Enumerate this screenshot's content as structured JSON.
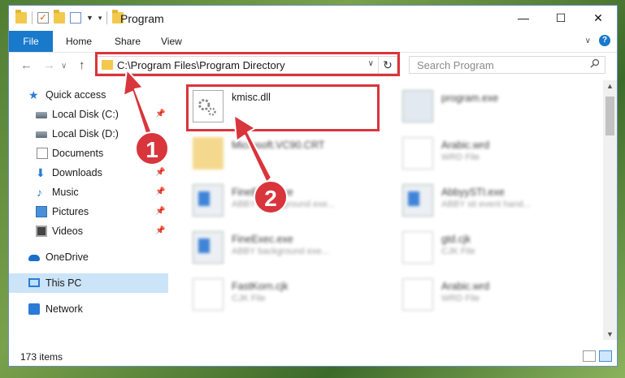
{
  "window": {
    "title": "Program",
    "controls": {
      "minimize": "—",
      "maximize": "☐",
      "close": "✕"
    }
  },
  "ribbon": {
    "file_tab": "File",
    "tabs": [
      "Home",
      "Share",
      "View"
    ],
    "help": "?"
  },
  "navigation": {
    "back": "←",
    "forward": "→",
    "up": "↑",
    "address": "C:\\Program Files\\Program Directory",
    "search_placeholder": "Search Program"
  },
  "sidebar": {
    "items": [
      {
        "label": "Quick access"
      },
      {
        "label": "Local Disk (C:)"
      },
      {
        "label": "Local Disk (D:)"
      },
      {
        "label": "Documents"
      },
      {
        "label": "Downloads"
      },
      {
        "label": "Music"
      },
      {
        "label": "Pictures"
      },
      {
        "label": "Videos"
      },
      {
        "label": "OneDrive"
      },
      {
        "label": "This PC"
      },
      {
        "label": "Network"
      }
    ]
  },
  "files": [
    {
      "name": "kmisc.dll",
      "desc": ""
    },
    {
      "name": "program.exe",
      "desc": ""
    },
    {
      "name": "Microsoft.VC90.CRT",
      "desc": ""
    },
    {
      "name": "Arabic.wrd",
      "desc": "WRD File"
    },
    {
      "name": "FineExec.exe",
      "desc": "ABBYY background exe..."
    },
    {
      "name": "AbbyySTI.exe",
      "desc": "ABBY sti event hand..."
    },
    {
      "name": "FineExec.exe",
      "desc": "ABBY background exe..."
    },
    {
      "name": "gtd.cjk",
      "desc": "CJK File"
    },
    {
      "name": "FastKorn.cjk",
      "desc": "CJK File"
    },
    {
      "name": "Arabic.wrd",
      "desc": "WRD File"
    }
  ],
  "status": {
    "item_count": "173 items"
  },
  "annotations": {
    "badge1": "1",
    "badge2": "2",
    "color": "#d9353c"
  }
}
